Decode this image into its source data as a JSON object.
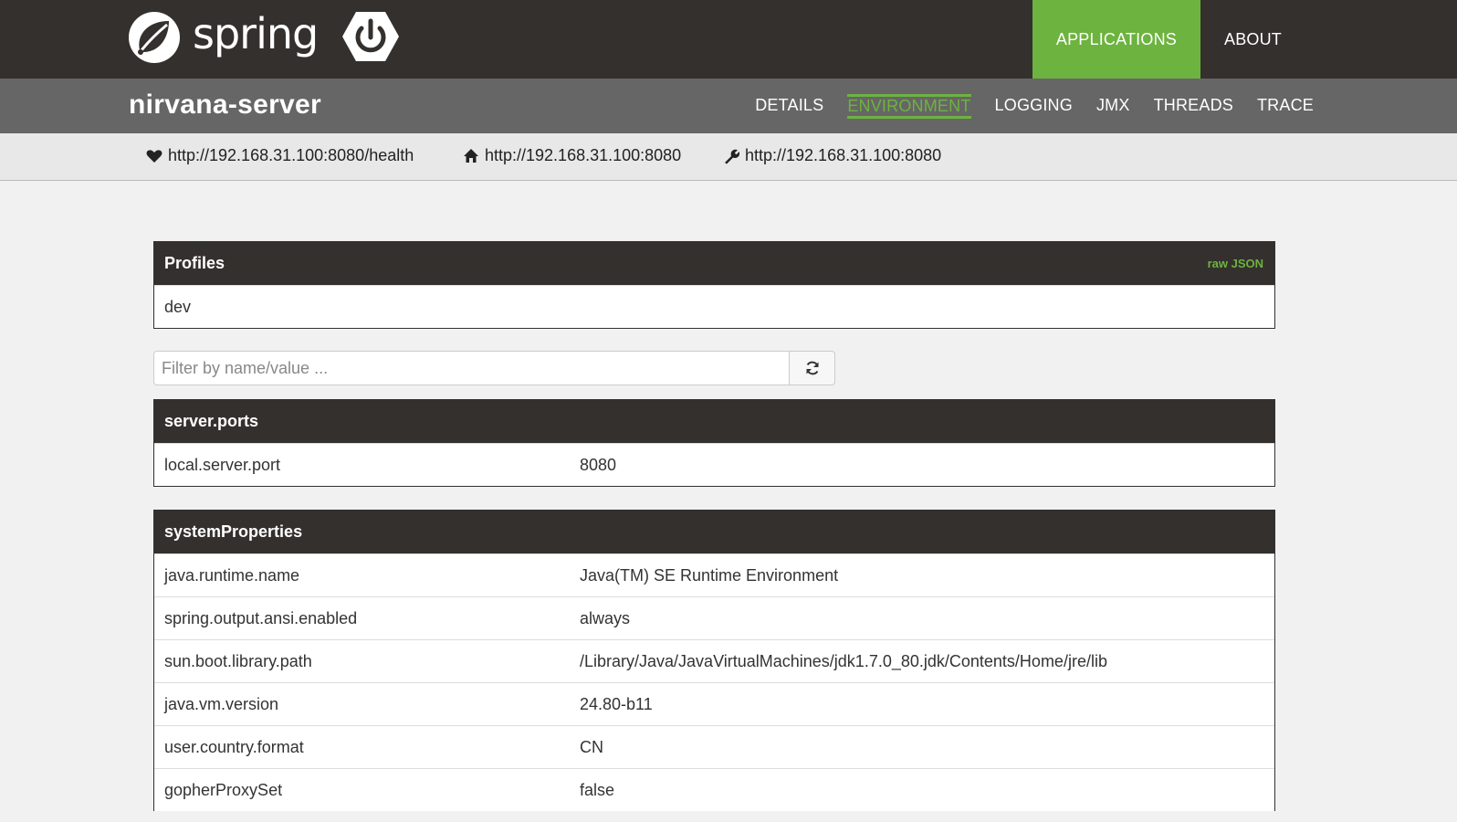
{
  "brand": {
    "wordmark": "spring",
    "accent": "#6db33f",
    "dark": "#34302d"
  },
  "top_nav": {
    "applications": "APPLICATIONS",
    "about": "ABOUT"
  },
  "app": {
    "name": "nirvana-server",
    "tabs": [
      "DETAILS",
      "ENVIRONMENT",
      "LOGGING",
      "JMX",
      "THREADS",
      "TRACE"
    ],
    "active_tab": "ENVIRONMENT"
  },
  "urls": {
    "health": "http://192.168.31.100:8080/health",
    "home": "http://192.168.31.100:8080",
    "management": "http://192.168.31.100:8080"
  },
  "profiles": {
    "title": "Profiles",
    "raw_json": "raw JSON",
    "value": "dev"
  },
  "filter": {
    "placeholder": "Filter by name/value ...",
    "value": ""
  },
  "server_ports": {
    "title": "server.ports",
    "rows": [
      {
        "key": "local.server.port",
        "value": "8080"
      }
    ]
  },
  "system_properties": {
    "title": "systemProperties",
    "rows": [
      {
        "key": "java.runtime.name",
        "value": "Java(TM) SE Runtime Environment"
      },
      {
        "key": "spring.output.ansi.enabled",
        "value": "always"
      },
      {
        "key": "sun.boot.library.path",
        "value": "/Library/Java/JavaVirtualMachines/jdk1.7.0_80.jdk/Contents/Home/jre/lib"
      },
      {
        "key": "java.vm.version",
        "value": "24.80-b11"
      },
      {
        "key": "user.country.format",
        "value": "CN"
      },
      {
        "key": "gopherProxySet",
        "value": "false"
      }
    ]
  }
}
